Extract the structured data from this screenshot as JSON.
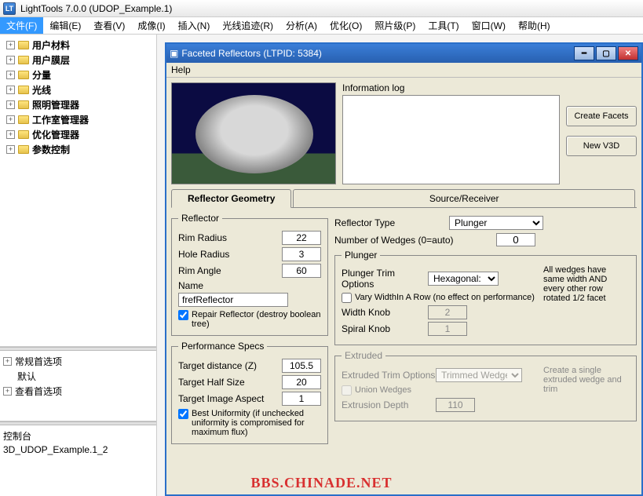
{
  "app": {
    "title": "LightTools 7.0.0  (UDOP_Example.1)",
    "icon": "LT"
  },
  "menubar": [
    "文件(F)",
    "编辑(E)",
    "查看(V)",
    "成像(I)",
    "插入(N)",
    "光线追迹(R)",
    "分析(A)",
    "优化(O)",
    "照片级(P)",
    "工具(T)",
    "窗口(W)",
    "帮助(H)"
  ],
  "tree1": [
    "用户材料",
    "用户膜层",
    "分量",
    "光线",
    "照明管理器",
    "工作室管理器",
    "优化管理器",
    "参数控制"
  ],
  "pane2": [
    "常规首选项",
    "默认",
    "查看首选项"
  ],
  "pane3": [
    "控制台",
    "3D_UDOP_Example.1_2"
  ],
  "child": {
    "title": "Faceted Reflectors (LTPID: 5384)",
    "menu": "Help",
    "info_label": "Information log",
    "btn_create": "Create Facets",
    "btn_new": "New V3D",
    "tabs": {
      "t1": "Reflector Geometry",
      "t2": "Source/Receiver"
    },
    "reflector": {
      "legend": "Reflector",
      "rim_radius_l": "Rim Radius",
      "rim_radius": "22",
      "hole_radius_l": "Hole Radius",
      "hole_radius": "3",
      "rim_angle_l": "Rim Angle",
      "rim_angle": "60",
      "name_l": "Name",
      "name": "frefReflector",
      "repair": "Repair Reflector (destroy boolean tree)"
    },
    "perf": {
      "legend": "Performance Specs",
      "target_dist_l": "Target distance (Z)",
      "target_dist": "105.5",
      "target_half_l": "Target Half Size",
      "target_half": "20",
      "target_aspect_l": "Target Image Aspect",
      "target_aspect": "1",
      "best_unif": "Best Uniformity (if unchecked uniformity is compromised for maximum flux)"
    },
    "refl_type_l": "Reflector Type",
    "refl_type": "Plunger",
    "num_wedges_l": "Number of Wedges (0=auto)",
    "num_wedges": "0",
    "plunger": {
      "legend": "Plunger",
      "trim_l": "Plunger Trim Options",
      "trim": "Hexagonal:",
      "note": "All wedges have same width AND every other row rotated 1/2 facet",
      "vary": "Vary WidthIn A Row (no effect on performance)",
      "width_knob_l": "Width Knob",
      "width_knob": "2",
      "spiral_knob_l": "Spiral Knob",
      "spiral_knob": "1"
    },
    "extruded": {
      "legend": "Extruded",
      "trim_l": "Extruded Trim Options",
      "trim": "Trimmed Wedge",
      "note": "Create a single extruded wedge and trim",
      "union": "Union Wedges",
      "depth_l": "Extrusion Depth",
      "depth": "110"
    }
  },
  "watermark": "BBS.CHINADE.NET"
}
